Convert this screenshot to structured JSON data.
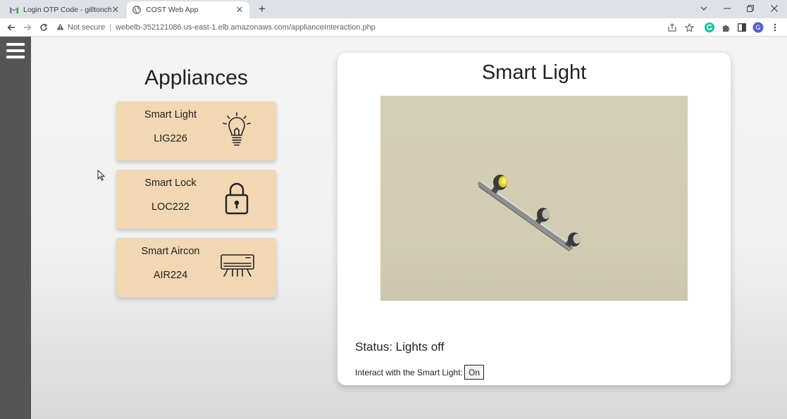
{
  "browser": {
    "tabs": [
      {
        "title": "Login OTP Code - gilltonchh@gr",
        "icon": "gmail-icon",
        "active": false
      },
      {
        "title": "COST Web App",
        "icon": "globe-icon",
        "active": true
      }
    ],
    "address": {
      "security_label": "Not secure",
      "url": "webelb-352121086.us-east-1.elb.amazonaws.com/applianceInteraction.php"
    },
    "profile_initial": "G"
  },
  "sidebar": {
    "menu_icon": "hamburger-icon"
  },
  "appliances": {
    "title": "Appliances",
    "items": [
      {
        "name": "Smart Light",
        "code": "LIG226",
        "icon": "lightbulb-icon"
      },
      {
        "name": "Smart Lock",
        "code": "LOC222",
        "icon": "padlock-icon"
      },
      {
        "name": "Smart Aircon",
        "code": "AIR224",
        "icon": "aircon-icon"
      }
    ]
  },
  "detail": {
    "title": "Smart Light",
    "image": "track-light-photo",
    "status": "Status: Lights off",
    "interact_label": "Interact with the Smart Light:",
    "button_label": "On"
  },
  "colors": {
    "card_bg": "#f2d7b3",
    "sidebar_bg": "#555555",
    "photo_bg": "#d3ceb6"
  }
}
